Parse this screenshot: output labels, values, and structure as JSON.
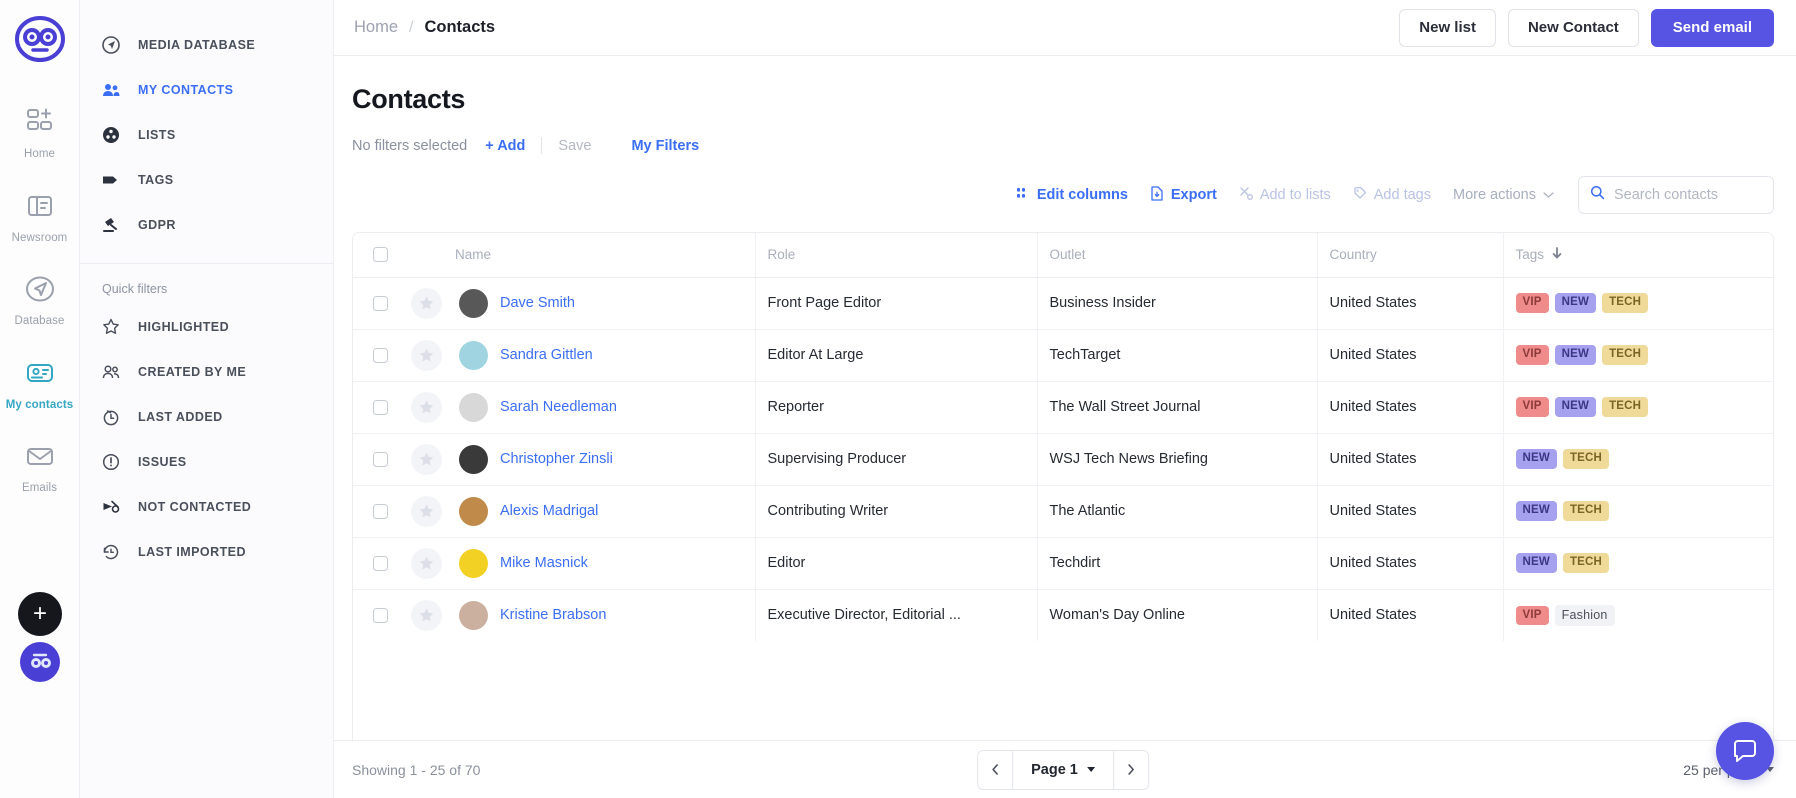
{
  "rail": {
    "logo": "owl-logo",
    "items": [
      {
        "label": "Home",
        "icon": "dashboard-icon",
        "active": false
      },
      {
        "label": "Newsroom",
        "icon": "book-icon",
        "active": false
      },
      {
        "label": "Database",
        "icon": "send-compass-icon",
        "active": false
      },
      {
        "label": "My contacts",
        "icon": "contact-card-icon",
        "active": true
      },
      {
        "label": "Emails",
        "icon": "envelope-icon",
        "active": false
      }
    ],
    "fab_label": "+",
    "avatar_label": "user-avatar"
  },
  "subnav": {
    "items": [
      {
        "label": "MEDIA DATABASE",
        "icon": "compass-icon",
        "active": false
      },
      {
        "label": "MY CONTACTS",
        "icon": "people-icon",
        "active": true
      },
      {
        "label": "LISTS",
        "icon": "lists-icon",
        "active": false
      },
      {
        "label": "TAGS",
        "icon": "tag-icon",
        "active": false
      },
      {
        "label": "GDPR",
        "icon": "gavel-icon",
        "active": false
      }
    ],
    "quick_filters_title": "Quick filters",
    "quick_filters": [
      {
        "label": "HIGHLIGHTED",
        "icon": "star-icon"
      },
      {
        "label": "CREATED BY ME",
        "icon": "people-icon"
      },
      {
        "label": "LAST ADDED",
        "icon": "clock-icon"
      },
      {
        "label": "ISSUES",
        "icon": "alert-circle-icon"
      },
      {
        "label": "NOT CONTACTED",
        "icon": "megaphone-off-icon"
      },
      {
        "label": "LAST IMPORTED",
        "icon": "history-icon"
      }
    ]
  },
  "header": {
    "breadcrumb_home": "Home",
    "breadcrumb_sep": "/",
    "breadcrumb_current": "Contacts",
    "new_list": "New list",
    "new_contact": "New Contact",
    "send_email": "Send email"
  },
  "page": {
    "title": "Contacts"
  },
  "filters": {
    "none_selected": "No filters selected",
    "add": "+ Add",
    "save": "Save",
    "my_filters": "My Filters"
  },
  "actions": {
    "edit_columns": "Edit columns",
    "export": "Export",
    "add_to_lists": "Add to lists",
    "add_tags": "Add tags",
    "more_actions": "More actions",
    "search_placeholder": "Search contacts",
    "search_value": ""
  },
  "table": {
    "columns": [
      "Name",
      "Role",
      "Outlet",
      "Country",
      "Tags"
    ],
    "sorted_column": "Tags",
    "sort_direction": "desc",
    "rows": [
      {
        "name": "Dave Smith",
        "role": "Front Page Editor",
        "outlet": "Business Insider",
        "country": "United States",
        "tags": [
          {
            "label": "VIP",
            "style": "vip"
          },
          {
            "label": "NEW",
            "style": "new"
          },
          {
            "label": "TECH",
            "style": "tech"
          }
        ],
        "avatar_color": "#585858"
      },
      {
        "name": "Sandra Gittlen",
        "role": "Editor At Large",
        "outlet": "TechTarget",
        "country": "United States",
        "tags": [
          {
            "label": "VIP",
            "style": "vip"
          },
          {
            "label": "NEW",
            "style": "new"
          },
          {
            "label": "TECH",
            "style": "tech"
          }
        ],
        "avatar_color": "#9fd4e0"
      },
      {
        "name": "Sarah Needleman",
        "role": "Reporter",
        "outlet": "The Wall Street Journal",
        "country": "United States",
        "tags": [
          {
            "label": "VIP",
            "style": "vip"
          },
          {
            "label": "NEW",
            "style": "new"
          },
          {
            "label": "TECH",
            "style": "tech"
          }
        ],
        "avatar_color": "#d8d8d8"
      },
      {
        "name": "Christopher Zinsli",
        "role": "Supervising Producer",
        "outlet": "WSJ Tech News Briefing",
        "country": "United States",
        "tags": [
          {
            "label": "NEW",
            "style": "new"
          },
          {
            "label": "TECH",
            "style": "tech"
          }
        ],
        "avatar_color": "#3a3a3a"
      },
      {
        "name": "Alexis Madrigal",
        "role": "Contributing Writer",
        "outlet": "The Atlantic",
        "country": "United States",
        "tags": [
          {
            "label": "NEW",
            "style": "new"
          },
          {
            "label": "TECH",
            "style": "tech"
          }
        ],
        "avatar_color": "#c08a4a"
      },
      {
        "name": "Mike Masnick",
        "role": "Editor",
        "outlet": "Techdirt",
        "country": "United States",
        "tags": [
          {
            "label": "NEW",
            "style": "new"
          },
          {
            "label": "TECH",
            "style": "tech"
          }
        ],
        "avatar_color": "#f2d024"
      },
      {
        "name": "Kristine Brabson",
        "role": "Executive Director, Editorial ...",
        "outlet": "Woman's Day Online",
        "country": "United States",
        "tags": [
          {
            "label": "VIP",
            "style": "vip"
          },
          {
            "label": "Fashion",
            "style": "plain"
          }
        ],
        "avatar_color": "#cbb0a0"
      }
    ]
  },
  "footer": {
    "showing": "Showing 1 - 25 of 70",
    "page_label": "Page 1",
    "per_page": "25 per page"
  },
  "colors": {
    "accent": "#5753e3",
    "link": "#3b6ef5",
    "active_rail": "#35a7c4",
    "tag_vip": "#f08b8b",
    "tag_new": "#a6a1ef",
    "tag_tech": "#f0da9a"
  }
}
